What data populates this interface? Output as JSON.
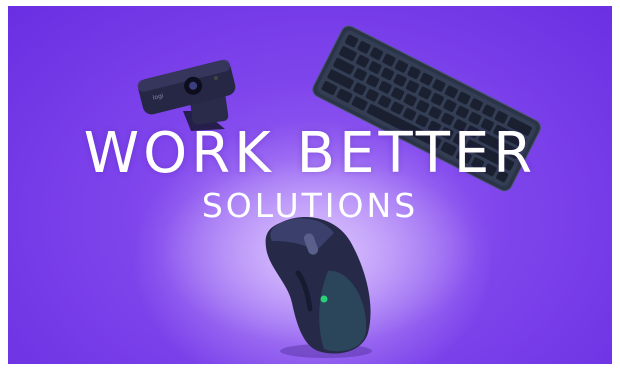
{
  "banner": {
    "headline": "WORK BETTER",
    "subheadline": "SOLUTIONS",
    "background_colors": [
      "#6a2fe2",
      "#9a66f4"
    ],
    "products": [
      "webcam",
      "keyboard",
      "mouse"
    ],
    "webcam_logo_text": "logi"
  }
}
